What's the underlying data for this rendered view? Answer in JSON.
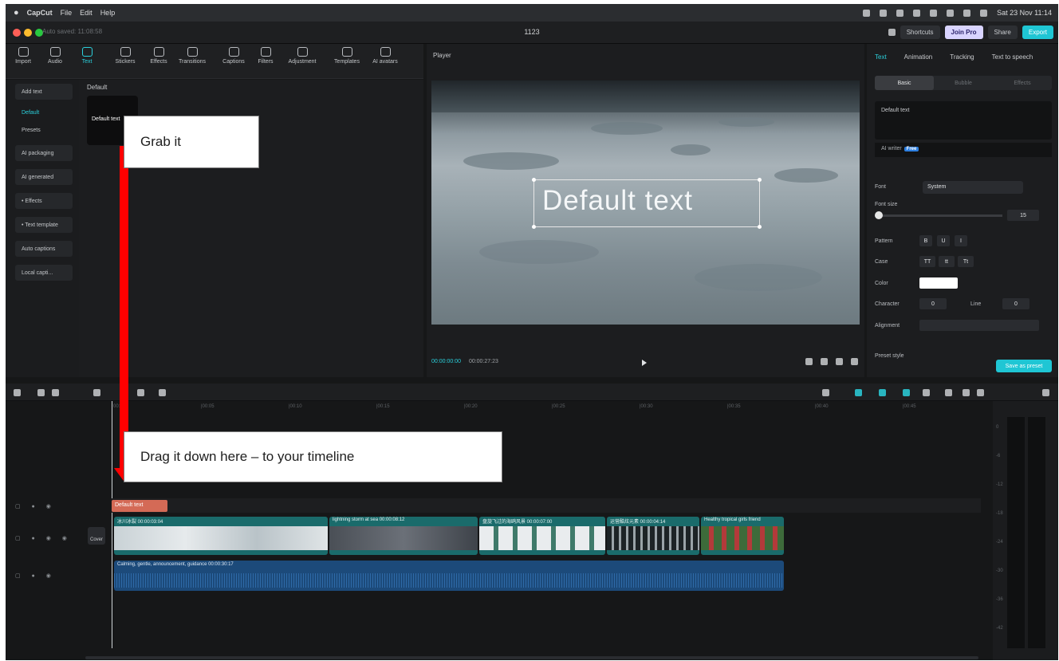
{
  "menubar": {
    "app_name": "CapCut",
    "items": [
      "File",
      "Edit",
      "Help"
    ],
    "datetime": "Sat 23 Nov 11:14"
  },
  "titlebar": {
    "autosave": "Auto saved: 11:08:58",
    "title": "1123",
    "shortcuts": "Shortcuts",
    "join_pro": "Join Pro",
    "share": "Share",
    "export": "Export"
  },
  "tools": [
    "Import",
    "Audio",
    "Text",
    "Stickers",
    "Effects",
    "Transitions",
    "Captions",
    "Filters",
    "Adjustment",
    "Templates",
    "AI avatars"
  ],
  "sidenav": {
    "add_text": "Add text",
    "items": [
      "Default",
      "Presets",
      "AI packaging",
      "AI generated",
      "• Effects",
      "• Text template",
      "Auto captions",
      "Local capti..."
    ]
  },
  "content": {
    "section_label": "Default",
    "card_text": "Default text"
  },
  "player": {
    "header": "Player",
    "overlay_text": "Default text",
    "time_current": "00:00:00:00",
    "time_total": "00:00:27:23"
  },
  "properties": {
    "tabs": [
      "Text",
      "Animation",
      "Tracking",
      "Text to speech"
    ],
    "subtabs": [
      "Basic",
      "Bubble",
      "Effects"
    ],
    "text_value": "Default text",
    "ai_writer": "AI writer",
    "ai_badge": "Free",
    "font_label": "Font",
    "font_value": "System",
    "font_size_label": "Font size",
    "font_size_value": "15",
    "pattern_label": "Pattern",
    "pattern_values": [
      "B",
      "U",
      "I"
    ],
    "case_label": "Case",
    "case_values": [
      "TT",
      "tt",
      "Tt"
    ],
    "color_label": "Color",
    "character_label": "Character",
    "character_value": "0",
    "line_label": "Line",
    "line_value": "0",
    "alignment_label": "Alignment",
    "preset_label": "Preset style",
    "save_preset": "Save as preset",
    "text_color": "#ffffff"
  },
  "timeline": {
    "ruler_ticks": [
      "00:00",
      "|00:05",
      "|00:10",
      "|00:15",
      "|00:20",
      "|00:25",
      "|00:30",
      "|00:35",
      "|00:40",
      "|00:45",
      "|00:50"
    ],
    "text_clip": "Default text",
    "cover_label": "Cover",
    "video_clips": [
      {
        "label": "冰川冰裂 00:00:03:04"
      },
      {
        "label": "lightning storm at sea 00:00:08:12"
      },
      {
        "label": "盘旋飞过的海鸥风景 00:00:07:00"
      },
      {
        "label": "运营酷炫元素 00:00:04:14"
      },
      {
        "label": "Healthy tropical girls friend"
      }
    ],
    "audio_clip": "Calming, gentle, announcement, guidance 00:00:30:17"
  },
  "meters": {
    "labels": [
      "0",
      "-6",
      "-12",
      "-18",
      "-24",
      "-30",
      "-36",
      "-42"
    ]
  },
  "annotations": {
    "grab": "Grab it",
    "drag": "Drag it down here – to your timeline",
    "arrow_color": "#ff0000"
  },
  "colors": {
    "accent": "#1fc6d4",
    "text_clip": "#d46a56",
    "video_clip": "#1a6b6b",
    "audio_clip": "#1c4a7a"
  }
}
